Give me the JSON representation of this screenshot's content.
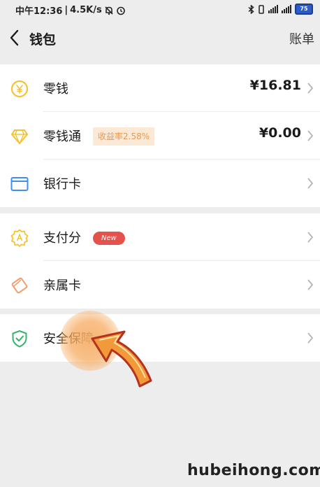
{
  "status_bar": {
    "time": "中午12:36",
    "speed": "4.5K/s",
    "battery": "75"
  },
  "nav": {
    "title": "钱包",
    "action": "账单"
  },
  "wallet_items": [
    {
      "label": "零钱",
      "value": "¥16.81",
      "icon": "yuan-coin-icon"
    },
    {
      "label": "零钱通",
      "badge": "收益率2.58%",
      "value": "¥0.00",
      "icon": "diamond-icon"
    },
    {
      "label": "银行卡",
      "icon": "bank-card-icon"
    }
  ],
  "service_items": [
    {
      "label": "支付分",
      "badge": "New",
      "icon": "payscore-badge-icon"
    },
    {
      "label": "亲属卡",
      "icon": "family-card-icon"
    }
  ],
  "security_item": {
    "label": "安全保障",
    "icon": "shield-check-icon"
  },
  "watermark": "hubeihong.com",
  "colors": {
    "accent_yellow": "#f5c330",
    "accent_blue": "#3e8ef0",
    "accent_green": "#37b36a",
    "badge_red": "#e5514c",
    "badge_orange": "#e99a52",
    "pointer_orange": "#f29a3a"
  }
}
